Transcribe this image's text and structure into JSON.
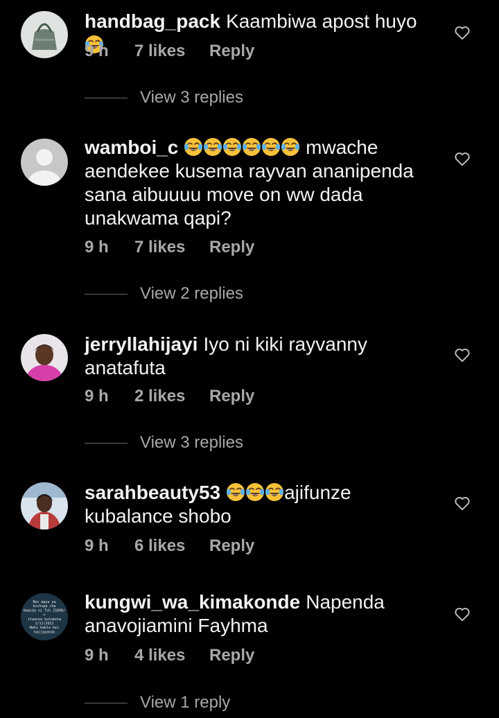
{
  "comments": [
    {
      "username": "handbag_pack",
      "text_before": "Kaambiwa apost huyo",
      "emoji_count": 1,
      "text_after": "",
      "time": "9 h",
      "likes": "7 likes",
      "reply": "Reply",
      "view_replies": "View 3 replies",
      "avatar_color": "#6d7f72",
      "liked": false
    },
    {
      "username": "wamboi_c",
      "text_before": "",
      "emoji_count": 6,
      "text_after": " mwache aendekee kusema rayvan ananipenda sana aibuuuu move on ww dada unakwama qapi?",
      "time": "9 h",
      "likes": "7 likes",
      "reply": "Reply",
      "view_replies": "View 2 replies",
      "avatar_color": "#c7c7c7",
      "liked": false
    },
    {
      "username": "jerryllahijayi",
      "text_before": "Iyo ni kiki rayvanny anatafuta",
      "emoji_count": 0,
      "text_after": "",
      "time": "9 h",
      "likes": "2 likes",
      "reply": "Reply",
      "view_replies": "View 3 replies",
      "avatar_color": "#d63fa8",
      "liked": false
    },
    {
      "username": "sarahbeauty53",
      "text_before": "",
      "emoji_count": 3,
      "text_after": "ajifunze kubalance shobo",
      "time": "9 h",
      "likes": "6 likes",
      "reply": "Reply",
      "view_replies": "",
      "avatar_color": "#5d86b8",
      "liked": false
    },
    {
      "username": "kungwi_wa_kimakonde",
      "text_before": "Napenda anavojiamini Fayhma",
      "emoji_count": 0,
      "text_after": "",
      "time": "9 h",
      "likes": "4 likes",
      "reply": "Reply",
      "view_replies": "View 1 reply",
      "avatar_color": "#1e3545",
      "avatar_text": [
        "Bei mpya ya",
        "kichupa cha",
        "Hamida ni Tsh 25000/",
        "=",
        "itaanza kutumika",
        "1/11/2021",
        "Wahi kabla bei",
        "haijapanda"
      ],
      "liked": false
    }
  ],
  "icons": {
    "heart": "heart-outline-icon",
    "emoji": "face-with-tears-of-joy-emoji"
  }
}
